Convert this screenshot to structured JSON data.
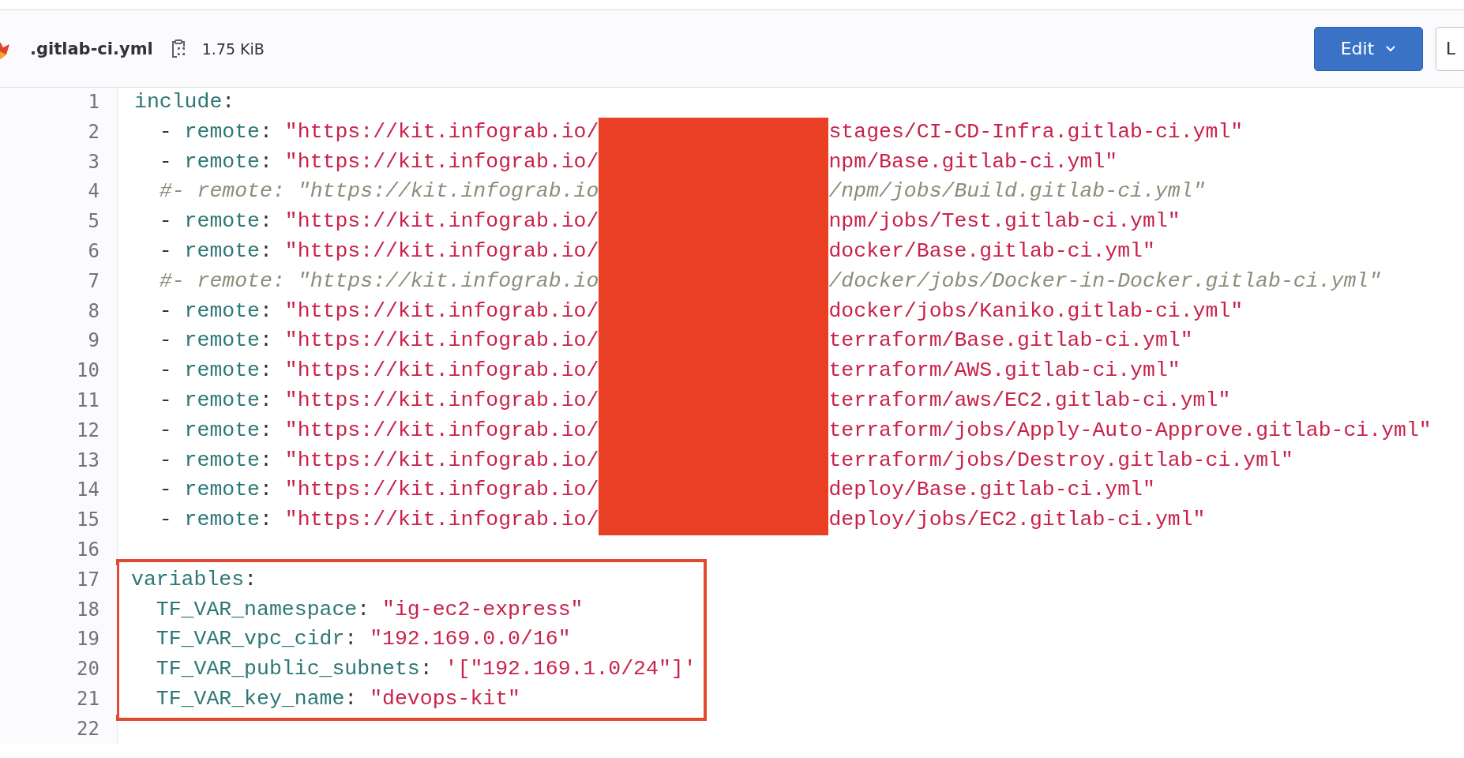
{
  "file_header": {
    "file_name": ".gitlab-ci.yml",
    "file_size": "1.75 KiB",
    "buttons": [
      {
        "label": "Edit",
        "kind": "primary",
        "dropdown": true
      },
      {
        "label": "L",
        "kind": "secondary"
      }
    ]
  },
  "code": {
    "lines": [
      {
        "number": "1",
        "highlighted": false,
        "indented": false,
        "segments": [
          {
            "kind": "key",
            "text": "include"
          },
          {
            "kind": "plain",
            "text": ":"
          }
        ]
      },
      {
        "number": "2",
        "highlighted": false,
        "indented": true,
        "segments": [
          {
            "kind": "plain",
            "text": "- "
          },
          {
            "kind": "key",
            "text": "remote"
          },
          {
            "kind": "plain",
            "text": ": "
          },
          {
            "kind": "string",
            "text": "\"https://kit.infograb.io/"
          },
          {
            "kind": "redacted"
          },
          {
            "kind": "string",
            "text": "stages/CI-CD-Infra.gitlab-ci.yml\""
          }
        ]
      },
      {
        "number": "3",
        "highlighted": false,
        "indented": true,
        "segments": [
          {
            "kind": "plain",
            "text": "- "
          },
          {
            "kind": "key",
            "text": "remote"
          },
          {
            "kind": "plain",
            "text": ": "
          },
          {
            "kind": "string",
            "text": "\"https://kit.infograb.io/"
          },
          {
            "kind": "redacted"
          },
          {
            "kind": "string",
            "text": "npm/Base.gitlab-ci.yml\""
          }
        ]
      },
      {
        "number": "4",
        "highlighted": false,
        "indented": true,
        "segments": [
          {
            "kind": "comment",
            "text": "#- remote: \"https://kit.infograb.io"
          },
          {
            "kind": "redacted"
          },
          {
            "kind": "comment",
            "text": "/npm/jobs/Build.gitlab-ci.yml\""
          }
        ]
      },
      {
        "number": "5",
        "highlighted": false,
        "indented": true,
        "segments": [
          {
            "kind": "plain",
            "text": "- "
          },
          {
            "kind": "key",
            "text": "remote"
          },
          {
            "kind": "plain",
            "text": ": "
          },
          {
            "kind": "string",
            "text": "\"https://kit.infograb.io/"
          },
          {
            "kind": "redacted"
          },
          {
            "kind": "string",
            "text": "npm/jobs/Test.gitlab-ci.yml\""
          }
        ]
      },
      {
        "number": "6",
        "highlighted": false,
        "indented": true,
        "segments": [
          {
            "kind": "plain",
            "text": "- "
          },
          {
            "kind": "key",
            "text": "remote"
          },
          {
            "kind": "plain",
            "text": ": "
          },
          {
            "kind": "string",
            "text": "\"https://kit.infograb.io/"
          },
          {
            "kind": "redacted"
          },
          {
            "kind": "string",
            "text": "docker/Base.gitlab-ci.yml\""
          }
        ]
      },
      {
        "number": "7",
        "highlighted": false,
        "indented": true,
        "segments": [
          {
            "kind": "comment",
            "text": "#- remote: \"https://kit.infograb.io"
          },
          {
            "kind": "redacted"
          },
          {
            "kind": "comment",
            "text": "/docker/jobs/Docker-in-Docker.gitlab-ci.yml\""
          }
        ]
      },
      {
        "number": "8",
        "highlighted": false,
        "indented": true,
        "segments": [
          {
            "kind": "plain",
            "text": "- "
          },
          {
            "kind": "key",
            "text": "remote"
          },
          {
            "kind": "plain",
            "text": ": "
          },
          {
            "kind": "string",
            "text": "\"https://kit.infograb.io/"
          },
          {
            "kind": "redacted"
          },
          {
            "kind": "string",
            "text": "docker/jobs/Kaniko.gitlab-ci.yml\""
          }
        ]
      },
      {
        "number": "9",
        "highlighted": false,
        "indented": true,
        "segments": [
          {
            "kind": "plain",
            "text": "- "
          },
          {
            "kind": "key",
            "text": "remote"
          },
          {
            "kind": "plain",
            "text": ": "
          },
          {
            "kind": "string",
            "text": "\"https://kit.infograb.io/"
          },
          {
            "kind": "redacted"
          },
          {
            "kind": "string",
            "text": "terraform/Base.gitlab-ci.yml\""
          }
        ]
      },
      {
        "number": "10",
        "highlighted": false,
        "indented": true,
        "segments": [
          {
            "kind": "plain",
            "text": "- "
          },
          {
            "kind": "key",
            "text": "remote"
          },
          {
            "kind": "plain",
            "text": ": "
          },
          {
            "kind": "string",
            "text": "\"https://kit.infograb.io/"
          },
          {
            "kind": "redacted"
          },
          {
            "kind": "string",
            "text": "terraform/AWS.gitlab-ci.yml\""
          }
        ]
      },
      {
        "number": "11",
        "highlighted": false,
        "indented": true,
        "segments": [
          {
            "kind": "plain",
            "text": "- "
          },
          {
            "kind": "key",
            "text": "remote"
          },
          {
            "kind": "plain",
            "text": ": "
          },
          {
            "kind": "string",
            "text": "\"https://kit.infograb.io/"
          },
          {
            "kind": "redacted"
          },
          {
            "kind": "string",
            "text": "terraform/aws/EC2.gitlab-ci.yml\""
          }
        ]
      },
      {
        "number": "12",
        "highlighted": false,
        "indented": true,
        "segments": [
          {
            "kind": "plain",
            "text": "- "
          },
          {
            "kind": "key",
            "text": "remote"
          },
          {
            "kind": "plain",
            "text": ": "
          },
          {
            "kind": "string",
            "text": "\"https://kit.infograb.io/"
          },
          {
            "kind": "redacted"
          },
          {
            "kind": "string",
            "text": "terraform/jobs/Apply-Auto-Approve.gitlab-ci.yml\""
          }
        ]
      },
      {
        "number": "13",
        "highlighted": false,
        "indented": true,
        "segments": [
          {
            "kind": "plain",
            "text": "- "
          },
          {
            "kind": "key",
            "text": "remote"
          },
          {
            "kind": "plain",
            "text": ": "
          },
          {
            "kind": "string",
            "text": "\"https://kit.infograb.io/"
          },
          {
            "kind": "redacted"
          },
          {
            "kind": "string",
            "text": "terraform/jobs/Destroy.gitlab-ci.yml\""
          }
        ]
      },
      {
        "number": "14",
        "highlighted": false,
        "indented": true,
        "segments": [
          {
            "kind": "plain",
            "text": "- "
          },
          {
            "kind": "key",
            "text": "remote"
          },
          {
            "kind": "plain",
            "text": ": "
          },
          {
            "kind": "string",
            "text": "\"https://kit.infograb.io/"
          },
          {
            "kind": "redacted"
          },
          {
            "kind": "string",
            "text": "deploy/Base.gitlab-ci.yml\""
          }
        ]
      },
      {
        "number": "15",
        "highlighted": false,
        "indented": true,
        "segments": [
          {
            "kind": "plain",
            "text": "- "
          },
          {
            "kind": "key",
            "text": "remote"
          },
          {
            "kind": "plain",
            "text": ": "
          },
          {
            "kind": "string",
            "text": "\"https://kit.infograb.io/"
          },
          {
            "kind": "redacted"
          },
          {
            "kind": "string",
            "text": "deploy/jobs/EC2.gitlab-ci.yml\""
          }
        ]
      },
      {
        "number": "16",
        "highlighted": false,
        "indented": false
      },
      {
        "number": "17",
        "highlighted": true,
        "indented": false,
        "segments": [
          {
            "kind": "key",
            "text": "variables"
          },
          {
            "kind": "plain",
            "text": ":"
          }
        ]
      },
      {
        "number": "18",
        "highlighted": true,
        "indented": true,
        "segments": [
          {
            "kind": "key",
            "text": "TF_VAR_namespace"
          },
          {
            "kind": "plain",
            "text": ": "
          },
          {
            "kind": "string",
            "text": "\"ig-ec2-express\""
          }
        ]
      },
      {
        "number": "19",
        "highlighted": true,
        "indented": true,
        "segments": [
          {
            "kind": "key",
            "text": "TF_VAR_vpc_cidr"
          },
          {
            "kind": "plain",
            "text": ": "
          },
          {
            "kind": "string",
            "text": "\"192.169.0.0/16\""
          }
        ]
      },
      {
        "number": "20",
        "highlighted": true,
        "indented": true,
        "segments": [
          {
            "kind": "key",
            "text": "TF_VAR_public_subnets"
          },
          {
            "kind": "plain",
            "text": ": "
          },
          {
            "kind": "string",
            "text": "'[\"192.169.1.0/24\"]'"
          }
        ]
      },
      {
        "number": "21",
        "highlighted": true,
        "indented": true,
        "segments": [
          {
            "kind": "key",
            "text": "TF_VAR_key_name"
          },
          {
            "kind": "plain",
            "text": ": "
          },
          {
            "kind": "string",
            "text": "\"devops-kit\""
          }
        ]
      },
      {
        "number": "22",
        "highlighted": false,
        "indented": false
      }
    ]
  }
}
